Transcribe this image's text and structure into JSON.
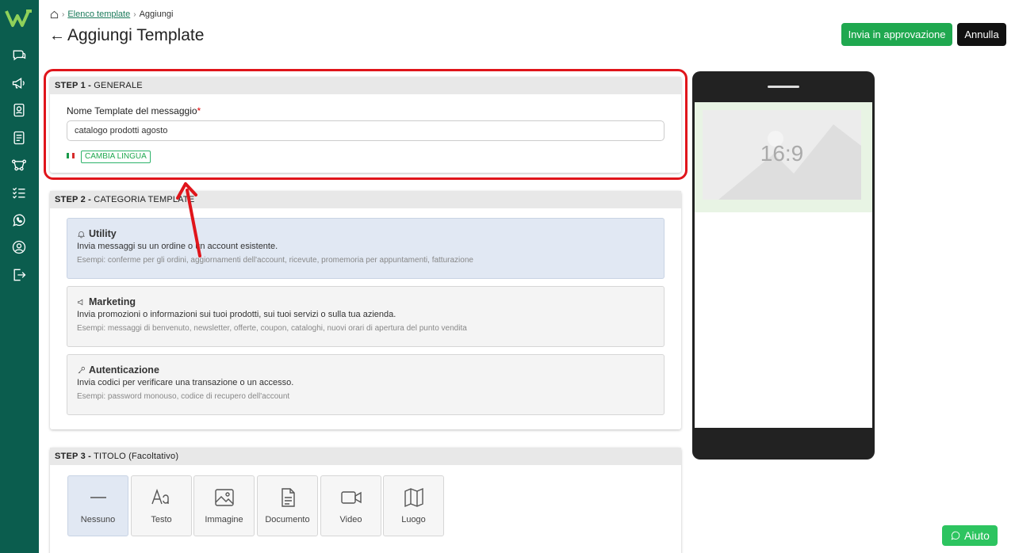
{
  "breadcrumb": {
    "home_icon": "home-icon",
    "list_link": "Elenco template",
    "current": "Aggiungi"
  },
  "header": {
    "title": "Aggiungi Template",
    "approve_label": "Invia in approvazione",
    "cancel_label": "Annulla"
  },
  "colors": {
    "sidebar": "#0b5d4e",
    "primary": "#1fa84f",
    "highlight": "#e0151b"
  },
  "sidebar": {
    "icons": [
      "chat-icon",
      "megaphone-icon",
      "contacts-icon",
      "document-icon",
      "flow-icon",
      "checklist-icon",
      "whatsapp-icon",
      "user-circle-icon",
      "logout-icon"
    ]
  },
  "step1": {
    "step_label": "STEP 1 -",
    "title": "GENERALE",
    "name_label": "Nome Template del messaggio",
    "required_mark": "*",
    "name_value": "catalogo prodotti agosto",
    "language_button": "CAMBIA LINGUA"
  },
  "step2": {
    "step_label": "STEP 2 -",
    "title": "CATEGORIA TEMPLATE",
    "categories": [
      {
        "title": "Utility",
        "description": "Invia messaggi su un ordine o un account esistente.",
        "examples": "Esempi: conferme per gli ordini, aggiornamenti dell'account, ricevute, promemoria per appuntamenti, fatturazione",
        "selected": true
      },
      {
        "title": "Marketing",
        "description": "Invia promozioni o informazioni sui tuoi prodotti, sui tuoi servizi o sulla tua azienda.",
        "examples": "Esempi: messaggi di benvenuto, newsletter, offerte, coupon, cataloghi, nuovi orari di apertura del punto vendita",
        "selected": false
      },
      {
        "title": "Autenticazione",
        "description": "Invia codici per verificare una transazione o un accesso.",
        "examples": "Esempi: password monouso, codice di recupero dell'account",
        "selected": false
      }
    ]
  },
  "step3": {
    "step_label": "STEP 3 -",
    "title": "TITOLO (Facoltativo)",
    "types": [
      "Nessuno",
      "Testo",
      "Immagine",
      "Documento",
      "Video",
      "Luogo"
    ]
  },
  "preview": {
    "ratio": "16:9"
  },
  "help": {
    "label": "Aiuto"
  }
}
